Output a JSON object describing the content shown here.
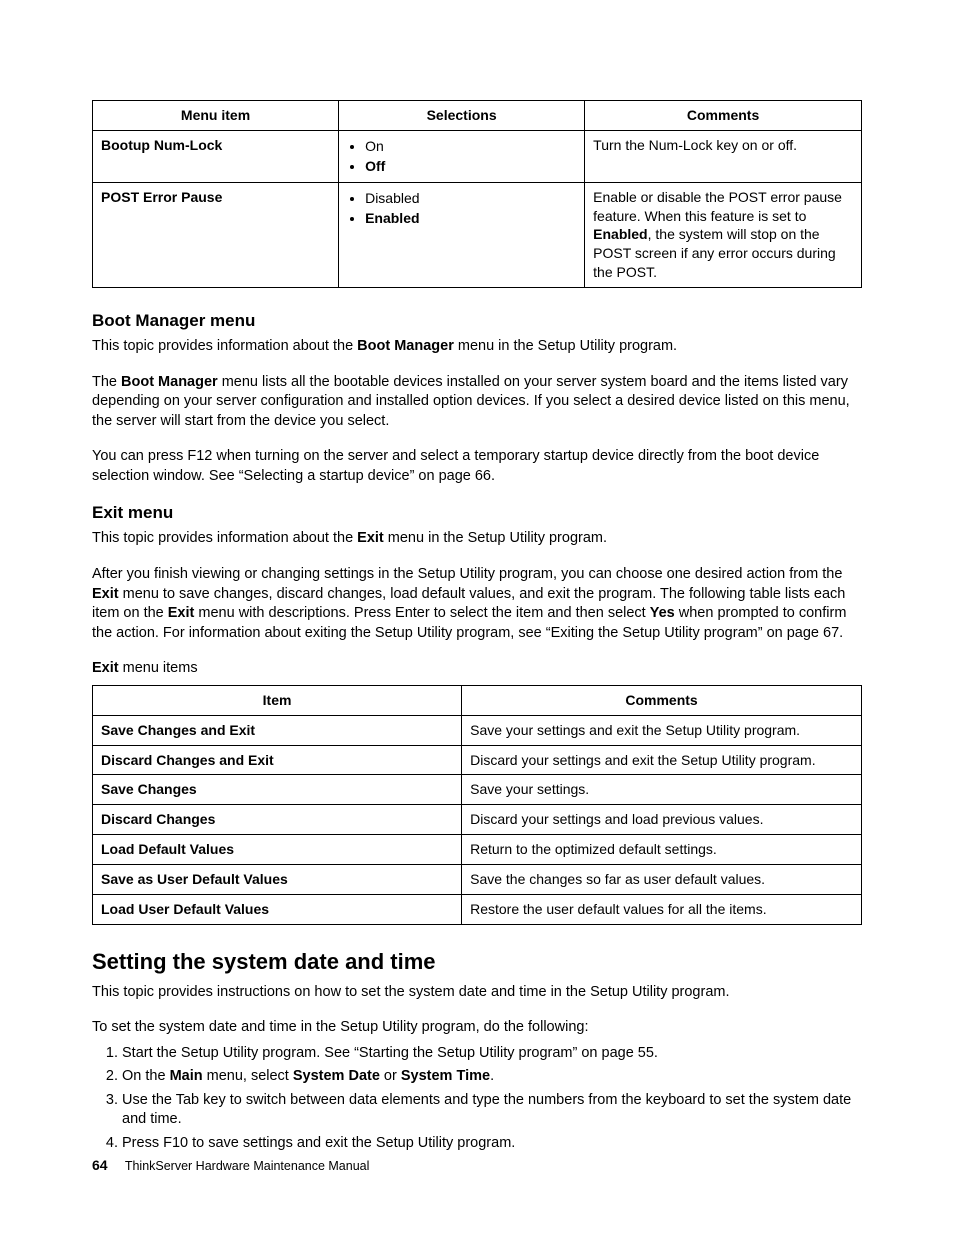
{
  "table1": {
    "headers": {
      "menu_item": "Menu item",
      "selections": "Selections",
      "comments": "Comments"
    },
    "rows": [
      {
        "item": "Bootup Num-Lock",
        "sel1": "On",
        "sel2": "Off",
        "comment": "Turn the Num-Lock key on or off."
      },
      {
        "item": "POST Error Pause",
        "sel1": "Disabled",
        "sel2": "Enabled",
        "comment_pre": "Enable or disable the POST error pause feature.  When this feature is set to ",
        "comment_bold": "Enabled",
        "comment_post": ", the system will stop on the POST screen if any error occurs during the POST."
      }
    ]
  },
  "boot_manager": {
    "heading": "Boot Manager menu",
    "p1_pre": "This topic provides information about the ",
    "p1_bold": "Boot Manager",
    "p1_post": " menu in the Setup Utility program.",
    "p2_pre": "The ",
    "p2_bold": "Boot Manager",
    "p2_post": " menu lists all the bootable devices installed on your server system board and the items listed vary depending on your server configuration and installed option devices.  If you select a desired device listed on this menu, the server will start from the device you select.",
    "p3": "You can press F12 when turning on the server and select a temporary startup device directly from the boot device selection window.  See “Selecting a startup device” on page 66."
  },
  "exit_menu": {
    "heading": "Exit menu",
    "p1_pre": "This topic provides information about the ",
    "p1_bold": "Exit",
    "p1_post": " menu in the Setup Utility program.",
    "p2_a": "After you finish viewing or changing settings in the Setup Utility program, you can choose one desired action from the ",
    "p2_b1": "Exit",
    "p2_b": " menu to save changes, discard changes, load default values, and exit the program.  The following table lists each item on the ",
    "p2_b2": "Exit",
    "p2_c": " menu with descriptions.  Press Enter to select the item and then select ",
    "p2_b3": "Yes",
    "p2_d": " when prompted to confirm the action.  For information about exiting the Setup Utility program, see “Exiting the Setup Utility program” on page 67.",
    "caption_bold": "Exit",
    "caption_rest": " menu items"
  },
  "exit_table": {
    "headers": {
      "item": "Item",
      "comments": "Comments"
    },
    "rows": [
      {
        "item": "Save Changes and Exit",
        "comment": "Save your settings and exit the Setup Utility program."
      },
      {
        "item": "Discard Changes and Exit",
        "comment": "Discard your settings and exit the Setup Utility program."
      },
      {
        "item": "Save Changes",
        "comment": "Save your settings."
      },
      {
        "item": "Discard Changes",
        "comment": "Discard your settings and load previous values."
      },
      {
        "item": "Load Default Values",
        "comment": "Return to the optimized default settings."
      },
      {
        "item": "Save as User Default Values",
        "comment": "Save the changes so far as user default values."
      },
      {
        "item": "Load User Default Values",
        "comment": "Restore the user default values for all the items."
      }
    ]
  },
  "datetime": {
    "heading": "Setting the system date and time",
    "p1": "This topic provides instructions on how to set the system date and time in the Setup Utility program.",
    "p2": "To set the system date and time in the Setup Utility program, do the following:",
    "steps": {
      "s1": "Start the Setup Utility program.  See “Starting the Setup Utility program” on page 55.",
      "s2_a": "On the ",
      "s2_b1": "Main",
      "s2_b": " menu, select ",
      "s2_b2": "System Date",
      "s2_c": " or ",
      "s2_b3": "System Time",
      "s2_d": ".",
      "s3": "Use the Tab key to switch between data elements and type the numbers from the keyboard to set the system date and time.",
      "s4": "Press F10 to save settings and exit the Setup Utility program."
    }
  },
  "footer": {
    "page": "64",
    "title": "ThinkServer Hardware Maintenance Manual"
  }
}
